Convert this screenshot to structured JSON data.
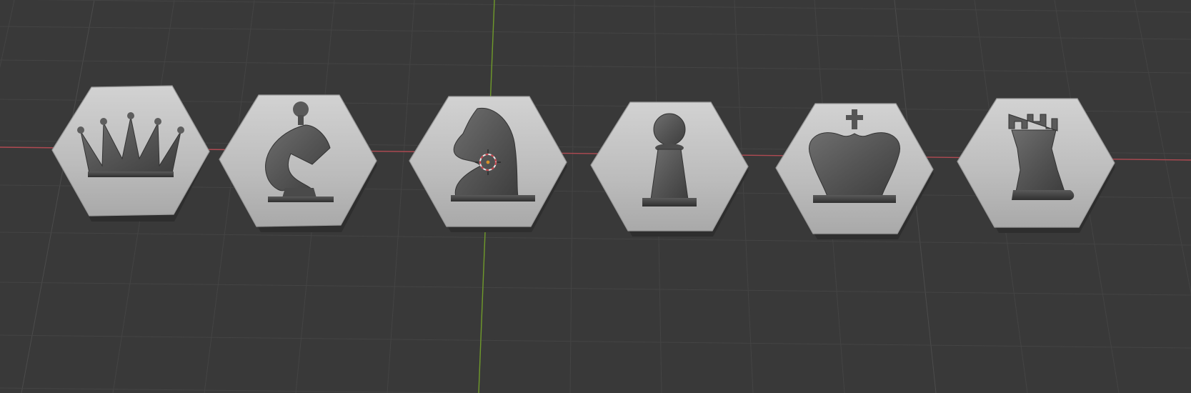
{
  "viewport": {
    "mode": "3d-viewport",
    "shading": "solid",
    "colors": {
      "background": "#393939",
      "grid_minor": "#444444",
      "grid_major": "#4c4c4c",
      "axis_x": "#b04a52",
      "axis_y": "#6f9a2a",
      "tile": "#b9b9b9",
      "tile_light": "#d3d3d3",
      "piece": "#575757",
      "piece_dark": "#3f3f3f",
      "cursor_ring": "#e8e8e8",
      "cursor_dash": "#c6424a"
    }
  },
  "scene": {
    "objects": [
      {
        "name": "queen",
        "icon": "queen-icon"
      },
      {
        "name": "bishop",
        "icon": "bishop-icon"
      },
      {
        "name": "knight",
        "icon": "knight-icon"
      },
      {
        "name": "pawn",
        "icon": "pawn-icon"
      },
      {
        "name": "king",
        "icon": "king-icon"
      },
      {
        "name": "rook",
        "icon": "rook-icon"
      }
    ]
  }
}
